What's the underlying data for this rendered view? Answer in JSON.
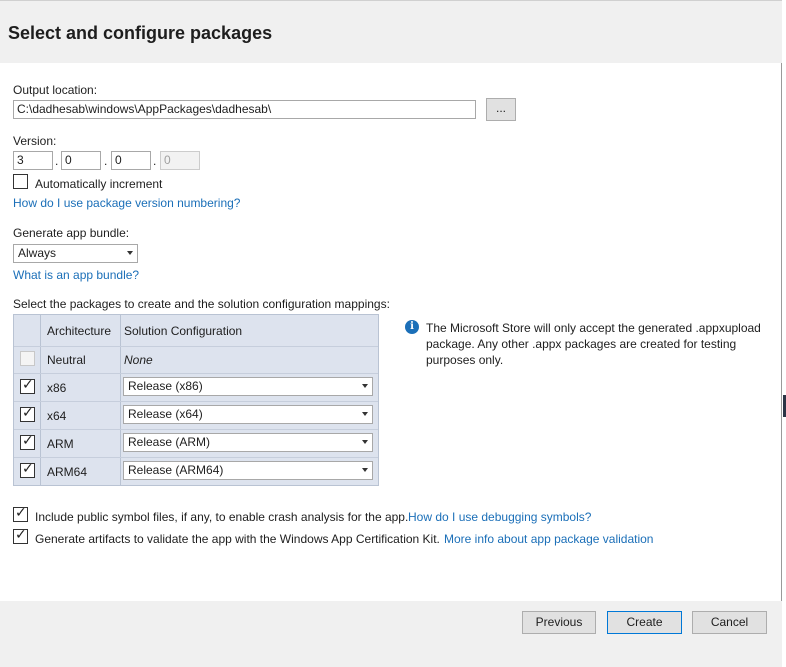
{
  "dialog": {
    "title": "Select and configure packages"
  },
  "output": {
    "label": "Output location:",
    "value": "C:\\dadhesab\\windows\\AppPackages\\dadhesab\\",
    "browse_label": "..."
  },
  "version": {
    "label": "Version:",
    "major": "3",
    "minor": "0",
    "build": "0",
    "revision": "0",
    "separator": ".",
    "auto_increment_label": "Automatically increment",
    "auto_increment_checked": false,
    "help_link": "How do I use package version numbering?"
  },
  "bundle": {
    "label": "Generate app bundle:",
    "selected": "Always",
    "help_link": "What is an app bundle?"
  },
  "packages": {
    "label": "Select the packages to create and the solution configuration mappings:",
    "headers": {
      "architecture": "Architecture",
      "configuration": "Solution Configuration"
    },
    "rows": [
      {
        "architecture": "Neutral",
        "configuration": "None",
        "checked": false
      },
      {
        "architecture": "x86",
        "configuration": "Release (x86)",
        "checked": true
      },
      {
        "architecture": "x64",
        "configuration": "Release (x64)",
        "checked": true
      },
      {
        "architecture": "ARM",
        "configuration": "Release (ARM)",
        "checked": true
      },
      {
        "architecture": "ARM64",
        "configuration": "Release (ARM64)",
        "checked": true
      }
    ]
  },
  "info": {
    "icon": "info-icon",
    "text": "The Microsoft Store will only accept the generated .appxupload package. Any other .appx packages are created for testing purposes only."
  },
  "options": {
    "symbols_label": "Include public symbol files, if any, to enable crash analysis for the app.",
    "symbols_link": "How do I use debugging symbols?",
    "symbols_checked": true,
    "artifacts_label": "Generate artifacts to validate the app with the Windows App Certification Kit.",
    "artifacts_link": "More info about app package validation",
    "artifacts_checked": true
  },
  "footer": {
    "previous": "Previous",
    "create": "Create",
    "cancel": "Cancel"
  },
  "colors": {
    "link": "#1b6fb8",
    "header_bg": "#f0f0f0",
    "grid_bg": "#dde3ee",
    "default_button_border": "#0078d7"
  }
}
